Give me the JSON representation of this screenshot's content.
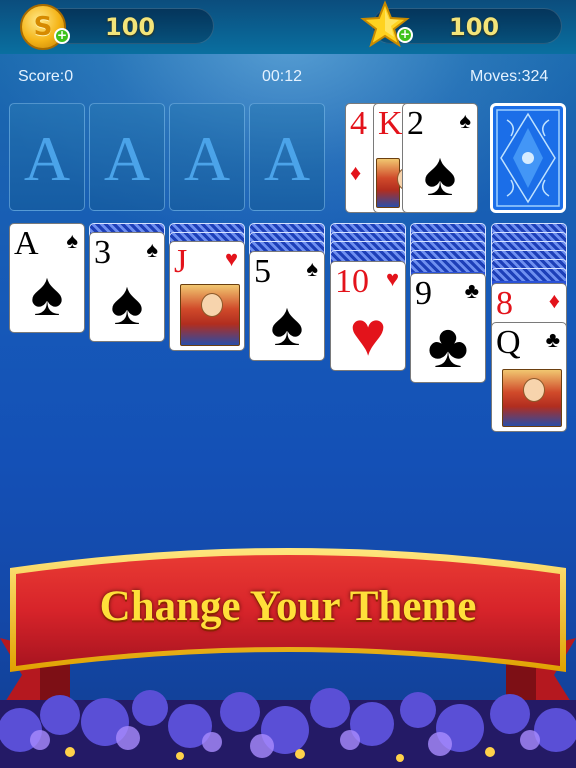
{
  "header": {
    "coins": "100",
    "stars": "100",
    "coin_symbol": "S",
    "plus": "+"
  },
  "status": {
    "score": "Score:0",
    "time": "00:12",
    "moves": "Moves:324"
  },
  "foundations": [
    "A",
    "A",
    "A",
    "A"
  ],
  "waste": [
    {
      "rank": "4",
      "suit": "♦",
      "color": "#e3131b"
    },
    {
      "rank": "K",
      "suit": "♣",
      "color": "#000000"
    },
    {
      "rank": "2",
      "suit": "♠",
      "color": "#000000"
    }
  ],
  "tableau": [
    {
      "rank": "A",
      "suit": "♠",
      "color": "#000000"
    },
    {
      "rank": "3",
      "suit": "♠",
      "color": "#000000"
    },
    {
      "rank": "J",
      "suit": "♥",
      "color": "#e3131b"
    },
    {
      "rank": "5",
      "suit": "♠",
      "color": "#000000"
    },
    {
      "rank": "10",
      "suit": "♥",
      "color": "#e3131b"
    },
    {
      "rank": "9",
      "suit": "♣",
      "color": "#000000"
    },
    {
      "rank": "8",
      "suit": "♦",
      "color": "#e3131b"
    },
    {
      "rank": "Q",
      "suit": "♣",
      "color": "#000000"
    }
  ],
  "banner": {
    "text": "Change Your Theme"
  },
  "colors": {
    "accent_gold": "#f3e47a",
    "banner_red": "#d7242a",
    "card_back_blue": "#1b6ee8"
  }
}
